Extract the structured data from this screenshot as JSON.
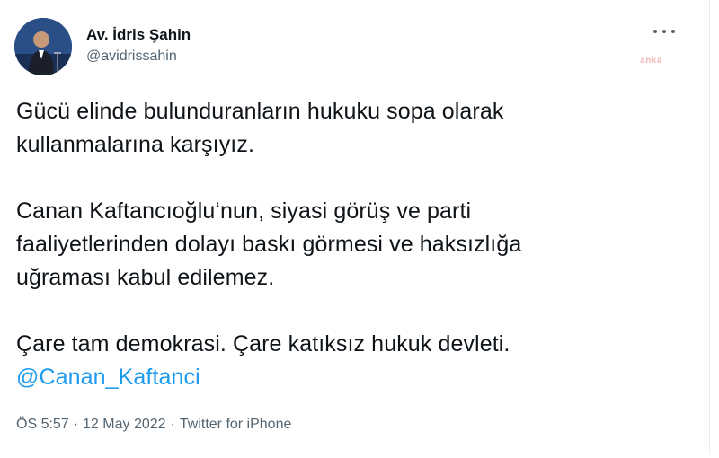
{
  "author": {
    "display_name": "Av. İdris Şahin",
    "handle": "@avidrissahin"
  },
  "header": {
    "more_icon": "more-horizontal-icon",
    "watermark": "anka"
  },
  "tweet": {
    "paragraph_1": {
      "line_1": "Gücü elinde bulunduranların hukuku sopa olarak",
      "line_2": "kullanmalarına karşıyız."
    },
    "paragraph_2": {
      "line_1": "Canan Kaftancıoğlu‘nun, siyasi görüş ve parti",
      "line_2": "faaliyetlerinden dolayı baskı görmesi ve haksızlığa",
      "line_3": "uğraması kabul edilemez."
    },
    "paragraph_3": {
      "line_1": "Çare tam demokrasi. Çare katıksız hukuk devleti.",
      "mention": "@Canan_Kaftanci"
    }
  },
  "meta": {
    "time": "ÖS 5:57",
    "date": "12 May 2022",
    "source": "Twitter for iPhone",
    "separator": "·"
  },
  "colors": {
    "text": "#0f1419",
    "secondary": "#536471",
    "link": "#1d9bf0"
  }
}
